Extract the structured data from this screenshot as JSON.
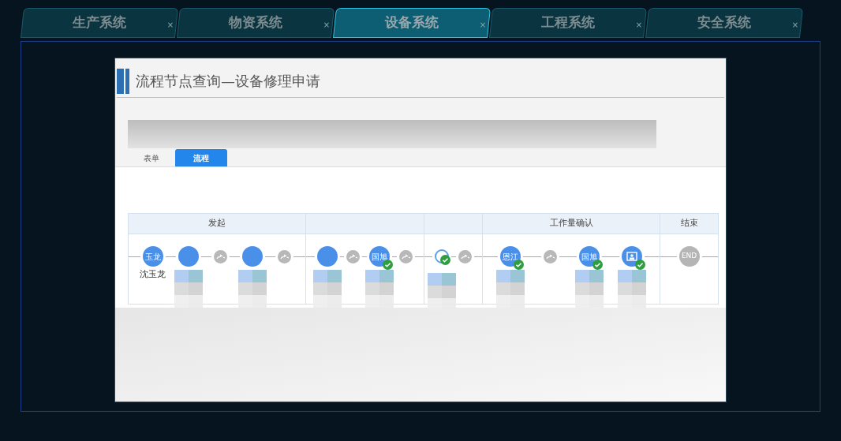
{
  "system_tabs": [
    {
      "label": "生产系统",
      "selected": false,
      "close": "×"
    },
    {
      "label": "物资系统",
      "selected": false,
      "close": "×"
    },
    {
      "label": "设备系统",
      "selected": true,
      "close": "×"
    },
    {
      "label": "工程系统",
      "selected": false,
      "close": "×"
    },
    {
      "label": "安全系统",
      "selected": false,
      "close": "×"
    }
  ],
  "page": {
    "title": "流程节点查询—设备修理申请",
    "tabs": [
      {
        "label": "表单",
        "selected": false
      },
      {
        "label": "流程",
        "selected": true
      }
    ],
    "flow": {
      "columns": [
        {
          "header": "发起",
          "nodes": [
            {
              "kind": "avatar",
              "label": "玉龙",
              "name": "沈玉龙"
            },
            {
              "kind": "avatar",
              "redacted": true
            },
            {
              "kind": "connector"
            },
            {
              "kind": "avatar",
              "redacted": true
            },
            {
              "kind": "connector"
            }
          ]
        },
        {
          "nodes": [
            {
              "kind": "avatar",
              "redacted": true
            },
            {
              "kind": "connector"
            },
            {
              "kind": "avatar",
              "label": "国旭",
              "checked": true,
              "redacted": true
            },
            {
              "kind": "connector"
            }
          ]
        },
        {
          "nodes": [
            {
              "kind": "pending",
              "checked": true,
              "redacted": true
            },
            {
              "kind": "connector"
            }
          ]
        },
        {
          "header": "工作量确认",
          "nodes": [
            {
              "kind": "avatar",
              "label": "恩江",
              "checked": true,
              "redacted": true
            },
            {
              "kind": "connector"
            },
            {
              "kind": "avatar",
              "label": "国旭",
              "checked": true,
              "redacted": true
            },
            {
              "kind": "screen",
              "checked": true,
              "redacted": true
            }
          ]
        },
        {
          "header": "结束",
          "nodes": [
            {
              "kind": "end",
              "label": "END"
            }
          ]
        }
      ]
    }
  }
}
